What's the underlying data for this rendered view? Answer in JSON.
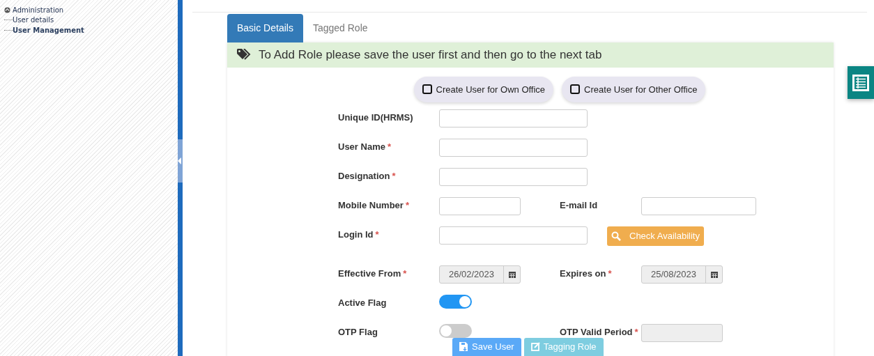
{
  "sidebar": {
    "tree": [
      {
        "label": "Administration",
        "selected": false,
        "children": [
          {
            "label": "User details",
            "selected": false
          },
          {
            "label": "User Management",
            "selected": true
          }
        ]
      }
    ]
  },
  "tabs": [
    {
      "label": "Basic Details",
      "selected": true
    },
    {
      "label": "Tagged Role",
      "selected": false
    }
  ],
  "alert": {
    "text": "To Add Role please save the user first and then go to the next tab"
  },
  "user_type_options": [
    {
      "label": "Create User for Own Office",
      "checked": false
    },
    {
      "label": "Create User for Other Office",
      "checked": false
    }
  ],
  "form_rows": [
    {
      "items": [
        {
          "kind": "text",
          "label": "Unique ID(HRMS)"
        }
      ]
    },
    {
      "items": [
        {
          "kind": "text",
          "label": "User Name",
          "mark": "*"
        }
      ]
    },
    {
      "items": [
        {
          "kind": "text",
          "label": "Designation",
          "mark": "*"
        }
      ]
    },
    {
      "items": [
        {
          "kind": "text",
          "label": "Mobile Number",
          "mark": "*"
        },
        {
          "kind": "text",
          "label": "E-mail Id"
        }
      ]
    },
    {
      "items": [
        {
          "kind": "text",
          "label": "Login Id",
          "mark": "*"
        },
        {
          "kind": "button",
          "label": "Check Availability"
        }
      ]
    },
    {
      "items": [
        {
          "kind": "date",
          "label": "Effective From",
          "mark": "*",
          "value": "26/02/2023"
        },
        {
          "kind": "date",
          "label": "Expires on",
          "mark": "*",
          "value": "25/08/2023"
        }
      ]
    },
    {
      "items": [
        {
          "kind": "toggle",
          "label": "Active Flag",
          "on": true
        }
      ]
    },
    {
      "items": [
        {
          "kind": "toggle",
          "label": "OTP Flag",
          "on": false
        },
        {
          "kind": "text",
          "label": "OTP Valid Period",
          "mark": "*",
          "disabled": true
        }
      ]
    }
  ],
  "actions": [
    {
      "kind": "save",
      "label": "Save User"
    },
    {
      "kind": "tag",
      "label": "Tagging Role"
    }
  ]
}
